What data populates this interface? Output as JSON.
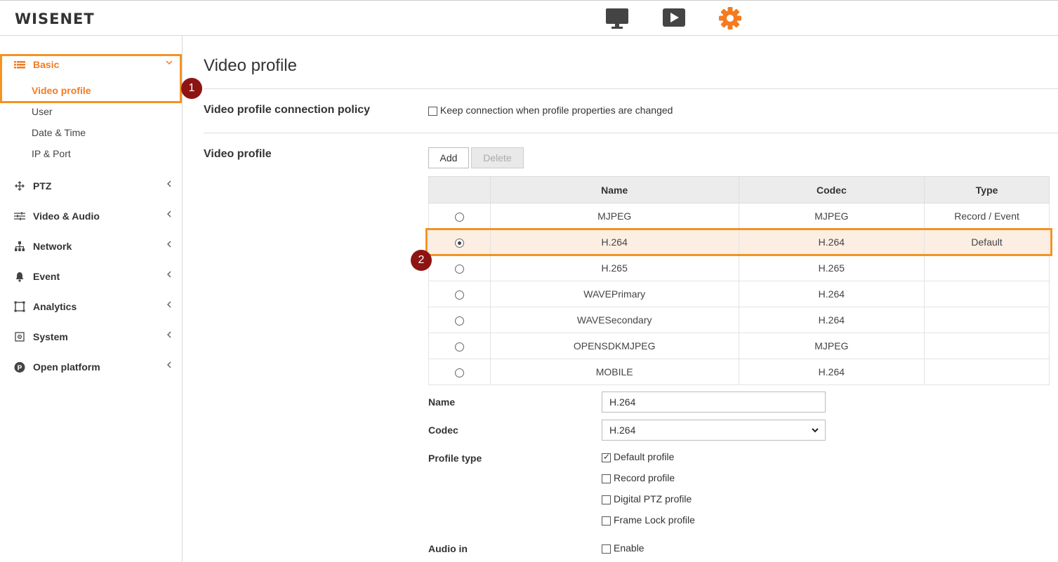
{
  "header": {
    "logo": "WISENET",
    "icons": [
      "monitor-icon",
      "play-icon",
      "gear-icon"
    ],
    "accent": "#f47b20"
  },
  "sidebar": {
    "basic": {
      "label": "Basic",
      "subitems": [
        "Video profile",
        "User",
        "Date & Time",
        "IP & Port"
      ]
    },
    "items": [
      {
        "label": "PTZ",
        "icon": "move-icon"
      },
      {
        "label": "Video & Audio",
        "icon": "sliders-icon"
      },
      {
        "label": "Network",
        "icon": "network-icon"
      },
      {
        "label": "Event",
        "icon": "bell-icon"
      },
      {
        "label": "Analytics",
        "icon": "analytics-icon"
      },
      {
        "label": "System",
        "icon": "system-icon"
      },
      {
        "label": "Open platform",
        "icon": "platform-icon"
      }
    ]
  },
  "annotations": {
    "badge1": "1",
    "badge2": "2",
    "color": "#f39322",
    "badge_color": "#8e1414"
  },
  "main": {
    "title": "Video profile",
    "policy": {
      "label": "Video profile connection policy",
      "checkbox_label": "Keep connection when profile properties are changed",
      "checked": false
    },
    "profiles": {
      "label": "Video profile",
      "add_label": "Add",
      "delete_label": "Delete",
      "columns": [
        "",
        "Name",
        "Codec",
        "Type"
      ],
      "rows": [
        {
          "name": "MJPEG",
          "codec": "MJPEG",
          "type": "Record / Event",
          "selected": false
        },
        {
          "name": "H.264",
          "codec": "H.264",
          "type": "Default",
          "selected": true
        },
        {
          "name": "H.265",
          "codec": "H.265",
          "type": "",
          "selected": false
        },
        {
          "name": "WAVEPrimary",
          "codec": "H.264",
          "type": "",
          "selected": false
        },
        {
          "name": "WAVESecondary",
          "codec": "H.264",
          "type": "",
          "selected": false
        },
        {
          "name": "OPENSDKMJPEG",
          "codec": "MJPEG",
          "type": "",
          "selected": false
        },
        {
          "name": "MOBILE",
          "codec": "H.264",
          "type": "",
          "selected": false
        }
      ]
    },
    "form": {
      "name_label": "Name",
      "name_value": "H.264",
      "codec_label": "Codec",
      "codec_value": "H.264",
      "profile_type_label": "Profile type",
      "profile_types": [
        {
          "label": "Default profile",
          "checked": true
        },
        {
          "label": "Record profile",
          "checked": false
        },
        {
          "label": "Digital PTZ profile",
          "checked": false
        },
        {
          "label": "Frame Lock profile",
          "checked": false
        }
      ],
      "audio_in_label": "Audio in",
      "audio_enable_label": "Enable",
      "audio_enable_checked": false
    }
  }
}
